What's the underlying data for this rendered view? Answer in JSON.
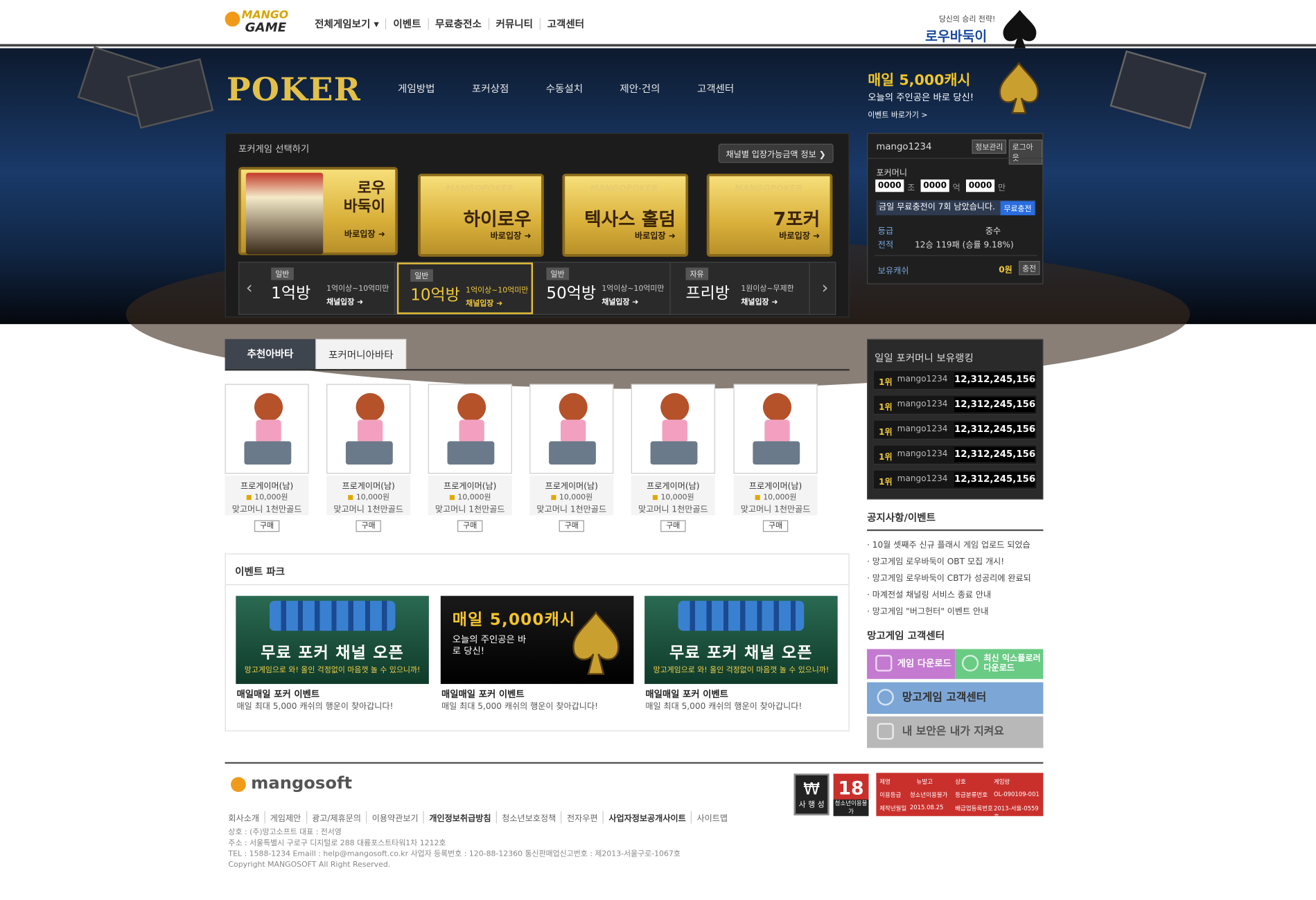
{
  "top": {
    "logo_line1": "MANGO",
    "logo_line2": "GAME",
    "nav": [
      "전체게임보기",
      "이벤트",
      "무료충전소",
      "커뮤니티",
      "고객센터"
    ],
    "ad_sub": "당신의 승리 전략!",
    "ad_title": "로우바둑이"
  },
  "hero": {
    "title": "POKER",
    "nav": [
      "게임방법",
      "포커상점",
      "수동설치",
      "제안·건의",
      "고객센터"
    ],
    "ad_title": "매일 5,000캐시",
    "ad_sub": "오늘의 주인공은 바로 당신!",
    "ad_link": "이벤트 바로가기 >"
  },
  "games": {
    "title": "포커게임 선택하기",
    "channel_btn": "채널별 입장가능금액 정보",
    "cards": [
      {
        "name": "로우\n바둑이",
        "sub": "바로입장"
      },
      {
        "name": "하이로우",
        "sub": "바로입장"
      },
      {
        "name": "텍사스 홀덤",
        "sub": "바로입장"
      },
      {
        "name": "7포커",
        "sub": "바로입장"
      }
    ],
    "watermark": "MANGOPOKER",
    "rooms": [
      {
        "tag": "일반",
        "name": "1억방",
        "range": "1억이상~10억미만",
        "enter": "채널입장"
      },
      {
        "tag": "일반",
        "name": "10억방",
        "range": "1억이상~10억미만",
        "enter": "채널입장"
      },
      {
        "tag": "일반",
        "name": "50억방",
        "range": "1억이상~10억미만",
        "enter": "채널입장"
      },
      {
        "tag": "자유",
        "name": "프리방",
        "range": "1원이상~무제한",
        "enter": "채널입장"
      }
    ]
  },
  "user": {
    "name": "mango1234",
    "btn_info": "정보관리",
    "btn_logout": "로그아웃",
    "money_label": "포커머니",
    "money": [
      "0000",
      "0000",
      "0000"
    ],
    "units": [
      "조",
      "억",
      "만"
    ],
    "free_text": "금일 무료충전이 7회 남았습니다.",
    "free_btn": "무료충전",
    "grade_label": "등급",
    "grade": "중수",
    "record_label": "전적",
    "record": "12승 119패 (승률 9.18%)",
    "cash_label": "보유캐쉬",
    "cash": "0원",
    "charge": "충전"
  },
  "avatar": {
    "tabs": [
      "추천아바타",
      "포커머니아바타"
    ],
    "items": [
      {
        "name": "프로게이머(남)",
        "price": "10,000원",
        "bonus": "맞고머니 1천만골드",
        "buy": "구매"
      },
      {
        "name": "프로게이머(남)",
        "price": "10,000원",
        "bonus": "맞고머니 1천만골드",
        "buy": "구매"
      },
      {
        "name": "프로게이머(남)",
        "price": "10,000원",
        "bonus": "맞고머니 1천만골드",
        "buy": "구매"
      },
      {
        "name": "프로게이머(남)",
        "price": "10,000원",
        "bonus": "맞고머니 1천만골드",
        "buy": "구매"
      },
      {
        "name": "프로게이머(남)",
        "price": "10,000원",
        "bonus": "맞고머니 1천만골드",
        "buy": "구매"
      },
      {
        "name": "프로게이머(남)",
        "price": "10,000원",
        "bonus": "맞고머니 1천만골드",
        "buy": "구매"
      }
    ]
  },
  "event": {
    "title": "이벤트 파크",
    "items": [
      {
        "banner_title": "무료 포커 채널 오픈",
        "banner_sub": "망고게임으로 와! 올인 걱정없이 마음껏 놀 수 있으니까!",
        "title": "매일매일 포커 이벤트",
        "desc": "매일 최대 5,000 캐쉬의 행운이 찾아갑니다!"
      },
      {
        "banner_title": "매일 5,000캐시",
        "banner_sub": "오늘의 주인공은 바로 당신!",
        "title": "매일매일 포커 이벤트",
        "desc": "매일 최대 5,000 캐쉬의 행운이 찾아갑니다!"
      },
      {
        "banner_title": "무료 포커 채널 오픈",
        "banner_sub": "망고게임으로 와! 올인 걱정없이 마음껏 놀 수 있으니까!",
        "title": "매일매일 포커 이벤트",
        "desc": "매일 최대 5,000 캐쉬의 행운이 찾아갑니다!"
      }
    ]
  },
  "ranking": {
    "title": "일일 포커머니 보유랭킹",
    "rows": [
      {
        "rank": "1위",
        "user": "mango1234",
        "value": "12,312,245,156"
      },
      {
        "rank": "1위",
        "user": "mango1234",
        "value": "12,312,245,156"
      },
      {
        "rank": "1위",
        "user": "mango1234",
        "value": "12,312,245,156"
      },
      {
        "rank": "1위",
        "user": "mango1234",
        "value": "12,312,245,156"
      },
      {
        "rank": "1위",
        "user": "mango1234",
        "value": "12,312,245,156"
      }
    ]
  },
  "notice": {
    "title": "공지사항/이벤트",
    "items": [
      "10월 셋째주 신규 플래시 게임 업로드 되었습",
      "망고게임 로우바둑이 OBT 모집 개시!",
      "망고게임 로우바둑이 CBT가 성공리에 완료되",
      "마계전설 채널링 서비스 종료 안내",
      "망고게임 \"버그헌터\" 이벤트 안내"
    ]
  },
  "cs": {
    "title": "망고게임 고객센터",
    "download": "게임 다운로드",
    "ie": "최신 익스플로러 다운로드",
    "center": "망고게임 고객센터",
    "security": "내 보안은 내가 지켜요"
  },
  "footer": {
    "logo": "mangosoft",
    "links": [
      "회사소개",
      "게임제안",
      "광고/제휴문의",
      "이용약관보기",
      "개인정보취급방침",
      "청소년보호정책",
      "전자우편",
      "사업자정보공개사이트",
      "사이트맵"
    ],
    "info": [
      "상호 : (주)망고소프트 대표 : 전서영",
      "주소 : 서울특별시 구로구 디지털로 288 대륭포스트타워1차 1212호",
      "TEL : 1588-1234 Emaill : help@mangosoft.co.kr 사업자 등록번호 : 120-88-12360 통신판매업신고번호 : 제2013-서울구로-1067호",
      "Copyright MANGOSOFT All Right Reserved."
    ],
    "badge1": "사 행 성",
    "badge2": "18",
    "badge2_sub": "청소년이용불가",
    "grid": [
      [
        "제명",
        "뉴발고",
        "상호",
        "게임랑"
      ],
      [
        "이용등급",
        "청소년이용불가",
        "등급분류번호",
        "OL-090109-001"
      ],
      [
        "제작년월일",
        "2015.08.25",
        "배급업등록번호",
        "2013-서울-0559호"
      ]
    ]
  }
}
